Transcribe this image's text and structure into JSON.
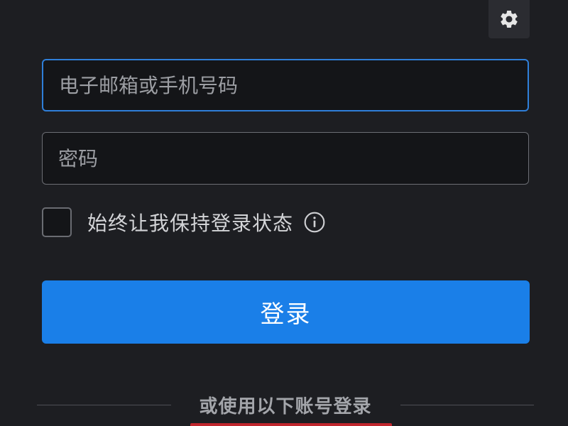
{
  "settings": {
    "icon": "gear-icon"
  },
  "login_form": {
    "email_placeholder": "电子邮箱或手机号码",
    "email_value": "",
    "password_placeholder": "密码",
    "password_value": "",
    "remember_label": "始终让我保持登录状态",
    "remember_checked": false,
    "info_icon": "info-icon",
    "login_button_label": "登录"
  },
  "alt_login": {
    "divider_text": "或使用以下账号登录"
  },
  "colors": {
    "background": "#1d1e22",
    "input_background": "#141518",
    "focus_border": "#2f7fd9",
    "primary_button": "#1a7fe8",
    "social_accent": "#c0262d"
  }
}
